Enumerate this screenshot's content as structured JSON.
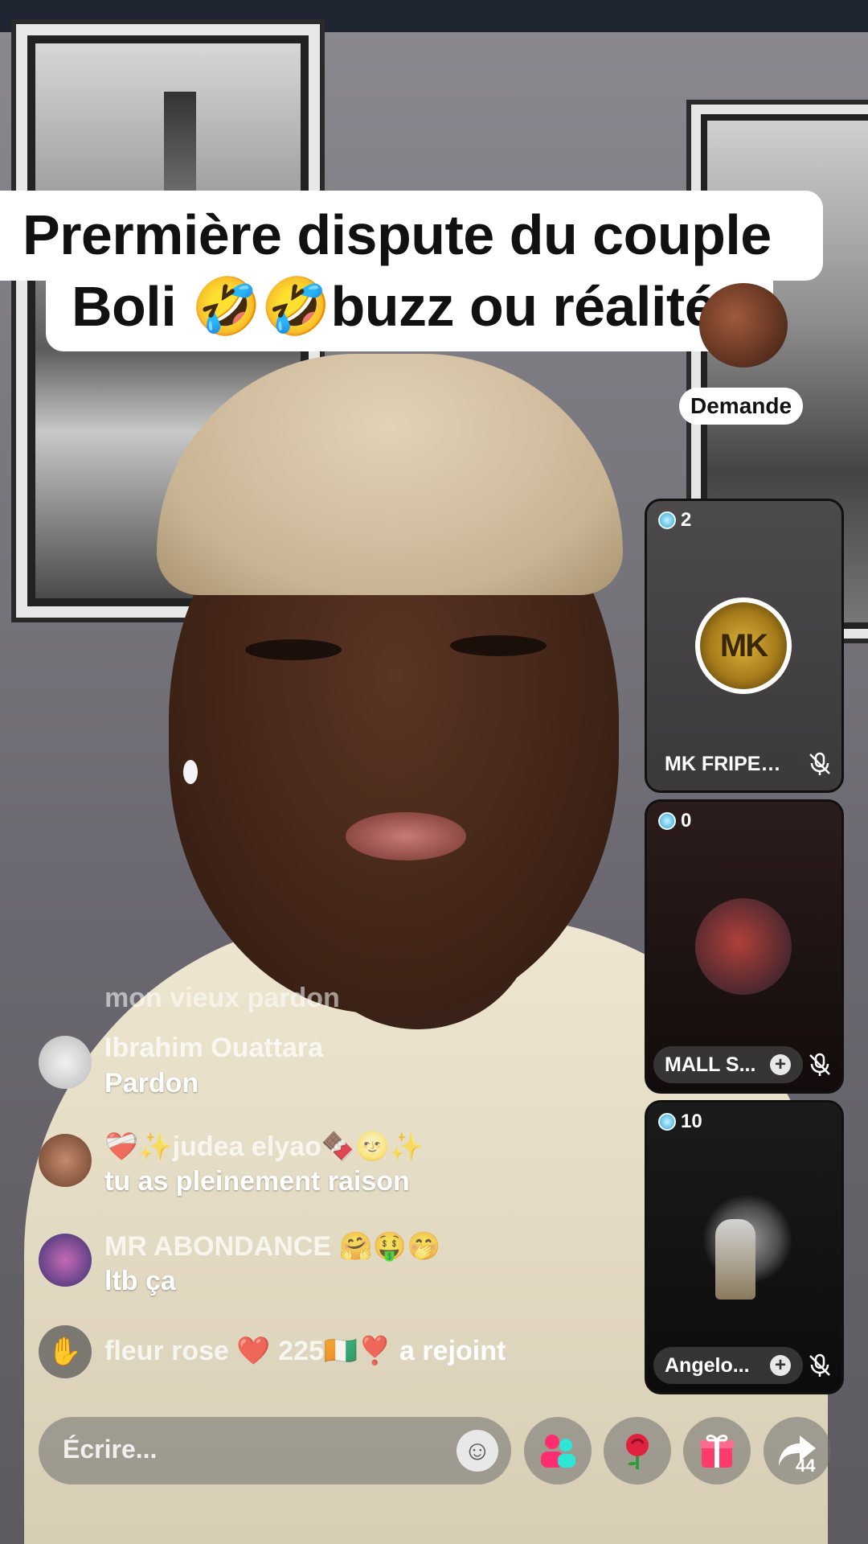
{
  "title": {
    "line1": "Prermière dispute du couple",
    "line2": "Boli 🤣🤣buzz ou réalité?"
  },
  "request_button": "Demande",
  "guests": [
    {
      "count": "2",
      "name": "MK FRIPER...",
      "avatar_text": "MK",
      "muted": true
    },
    {
      "count": "0",
      "name": "MALL S...",
      "follow": "+",
      "muted": true
    },
    {
      "count": "10",
      "name": "Angelo...",
      "follow": "+",
      "muted": true
    }
  ],
  "chat": {
    "faded_line": "mon vieux pardon",
    "messages": [
      {
        "user": "Ibrahim Ouattara",
        "text": "Pardon"
      },
      {
        "user": "❤️‍🩹✨judea elyao🍫🌝✨",
        "text": "tu as pleinement raison"
      },
      {
        "user": "MR ABONDANCE 🤗🤑🤭",
        "text": "ltb ça"
      }
    ],
    "join": {
      "user": "fleur rose ❤️ 225🇨🇮❣️",
      "action": "a rejoint"
    }
  },
  "bottom_bar": {
    "input_placeholder": "Écrire...",
    "share_count": "44"
  },
  "icons": {
    "emoji": "smiley-icon",
    "guests": "people-icon",
    "rose": "rose-icon",
    "gift": "gift-icon",
    "share": "share-arrow-icon",
    "wave": "wave-hand-icon",
    "mute": "mic-off-icon",
    "gem": "diamond-icon"
  },
  "colors": {
    "accent_guests": "#ff2d6f",
    "accent_teal": "#2ee6d6",
    "gift": "#ff3b6b"
  }
}
